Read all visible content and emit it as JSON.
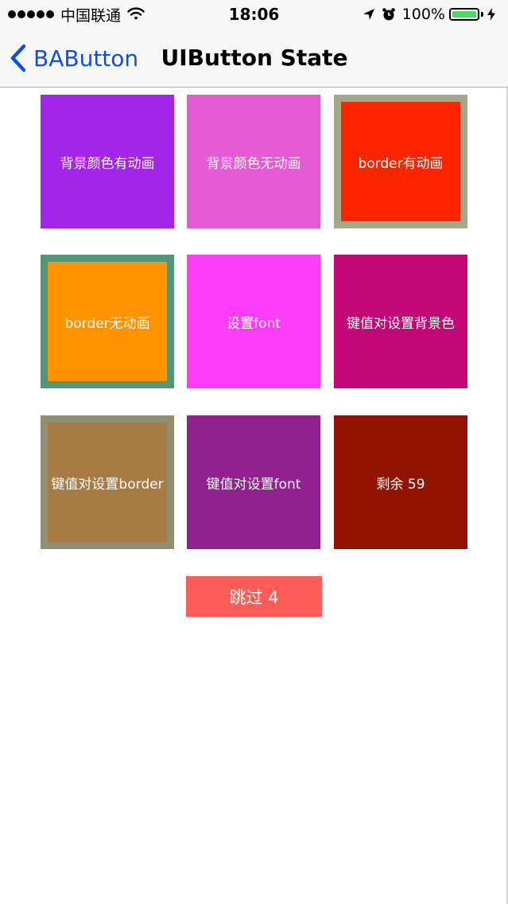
{
  "status_bar": {
    "carrier": "中国联通",
    "time": "18:06",
    "battery": "100%"
  },
  "nav": {
    "back_label": "BAButton",
    "title": "UIButton State"
  },
  "buttons": [
    {
      "label": "背景颜色有动画",
      "bg": "#a425ea"
    },
    {
      "label": "背景颜色无动画",
      "bg": "#e75ad5"
    },
    {
      "label": "border有动画",
      "bg": "#ff2400",
      "border": "#a3a88b"
    },
    {
      "label": "border无动画",
      "bg": "#ff9300",
      "border": "#559479"
    },
    {
      "label": "设置font",
      "bg": "#ff3df8"
    },
    {
      "label": "键值对设置背景色",
      "bg": "#c20876"
    },
    {
      "label": "键值对设置border",
      "bg": "#a67b44",
      "border": "#918f72"
    },
    {
      "label": "键值对设置font",
      "bg": "#922190"
    },
    {
      "label": "剩余 59",
      "bg": "#921300"
    }
  ],
  "skip_button": {
    "label": "跳过 4",
    "bg": "#fe5c57"
  },
  "colors": {
    "accent": "#0f4fe0",
    "nav_background": "#f7f7f7",
    "battery": "#4cd964"
  }
}
